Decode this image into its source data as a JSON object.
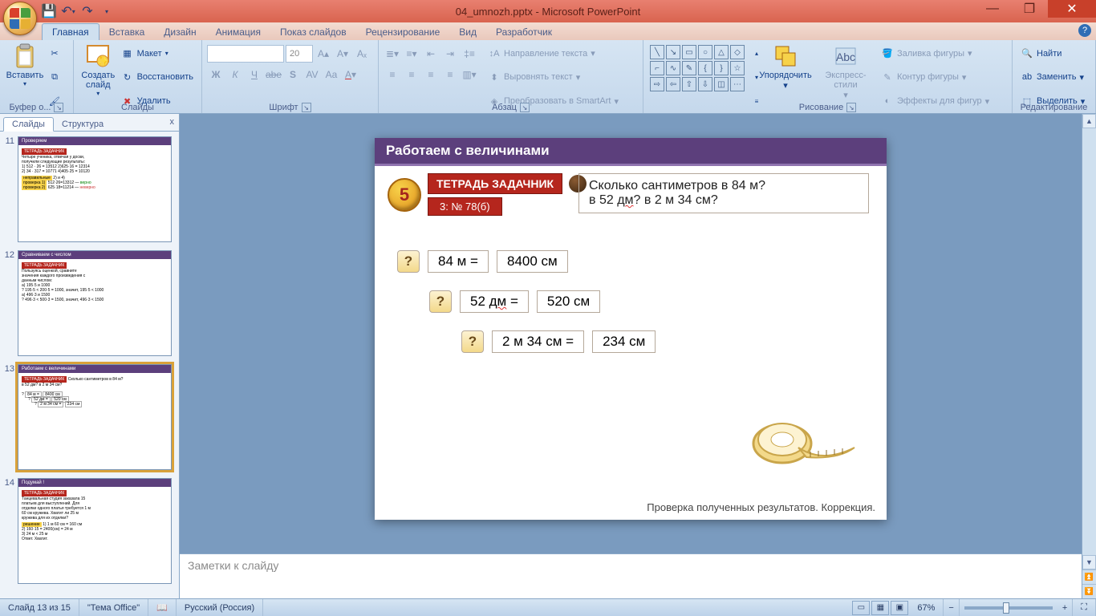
{
  "title": "04_umnozh.pptx - Microsoft PowerPoint",
  "qat": {
    "save": "💾",
    "undo": "↶",
    "redo": "↷"
  },
  "tabs": [
    "Главная",
    "Вставка",
    "Дизайн",
    "Анимация",
    "Показ слайдов",
    "Рецензирование",
    "Вид",
    "Разработчик"
  ],
  "active_tab": 0,
  "ribbon": {
    "clipboard": {
      "label": "Буфер о...",
      "paste": "Вставить"
    },
    "slides": {
      "label": "Слайды",
      "new": "Создать\nслайд",
      "layout": "Макет",
      "reset": "Восстановить",
      "delete": "Удалить"
    },
    "font": {
      "label": "Шрифт",
      "size": "20"
    },
    "paragraph": {
      "label": "Абзац",
      "direction": "Направление текста",
      "align": "Выровнять текст",
      "smartart": "Преобразовать в SmartArt"
    },
    "drawing": {
      "label": "Рисование",
      "arrange": "Упорядочить",
      "styles": "Экспресс-стили",
      "fill": "Заливка фигуры",
      "outline": "Контур фигуры",
      "effects": "Эффекты для фигур"
    },
    "editing": {
      "label": "Редактирование",
      "find": "Найти",
      "replace": "Заменить",
      "select": "Выделить"
    }
  },
  "slides_panel": {
    "tabs": [
      "Слайды",
      "Структура"
    ],
    "active": 0,
    "close": "x"
  },
  "thumbs": [
    {
      "num": "11",
      "title": "Проверяем"
    },
    {
      "num": "12",
      "title": "Сравниваем с числом"
    },
    {
      "num": "13",
      "title": "Работаем с величинами",
      "selected": true
    },
    {
      "num": "14",
      "title": "Подумай !"
    }
  ],
  "slide": {
    "header": "Работаем с величинами",
    "badge_num": "5",
    "badge_text": "ТЕТРАДЬ ЗАДАЧНИК",
    "badge_sub": "3: № 78(б)",
    "question_l1": "Сколько сантиметров  в 84 м?",
    "question_l2_a": "в 52 ",
    "question_l2_b": "дм",
    "question_l2_c": "?     в 2 м 34 см?",
    "rows": [
      {
        "indent": 0,
        "left": "84 м =",
        "right": "8400 см"
      },
      {
        "indent": 40,
        "left": "52 дм =",
        "right": "520 см",
        "wavy": true
      },
      {
        "indent": 80,
        "left": "2 м 34 см =",
        "right": "234 см"
      }
    ],
    "footer": "Проверка полученных результатов. Коррекция."
  },
  "notes_placeholder": "Заметки к слайду",
  "status": {
    "slide": "Слайд 13 из 15",
    "theme": "\"Тема Office\"",
    "lang": "Русский (Россия)",
    "zoom": "67%"
  }
}
